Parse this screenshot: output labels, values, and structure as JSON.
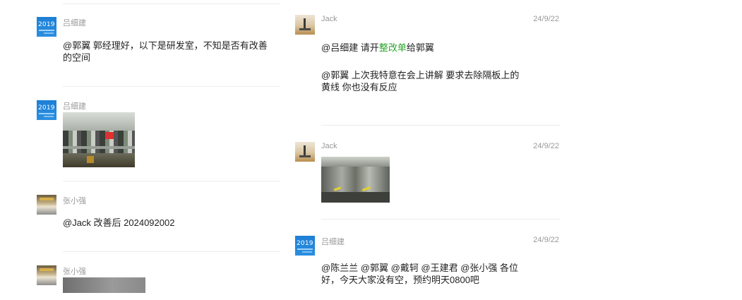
{
  "left_column": {
    "messages": [
      {
        "author": "吕细建",
        "text": "@郭翼  郭经理好，以下是研发室，不知是否有改善的空间"
      },
      {
        "author": "吕细建",
        "image": "lab-photo"
      },
      {
        "author": "张小强",
        "text": "@Jack  改善后 2024092002"
      },
      {
        "author": "张小强",
        "image": "gray-photo"
      }
    ]
  },
  "right_column": {
    "messages": [
      {
        "author": "Jack",
        "date": "24/9/22",
        "text_line1_prefix": "@吕细建 请开",
        "text_line1_link": "整改单",
        "text_line1_suffix": "给郭翼",
        "text_para2": "@郭翼 上次我特意在会上讲解 要求去除隔板上的黄线 你也没有反应"
      },
      {
        "author": "Jack",
        "date": "24/9/22",
        "image": "machine-photo"
      },
      {
        "author": "吕细建",
        "date": "24/9/22",
        "text": "@陈兰兰 @郭翼 @戴轲 @王建君 @张小强 各位好，今天大家没有空，预约明天0800吧"
      }
    ]
  },
  "avatar_labels": {
    "year": "2019"
  },
  "colors": {
    "link": "#2aa52a",
    "meta": "#999999",
    "separator": "#ececec"
  }
}
